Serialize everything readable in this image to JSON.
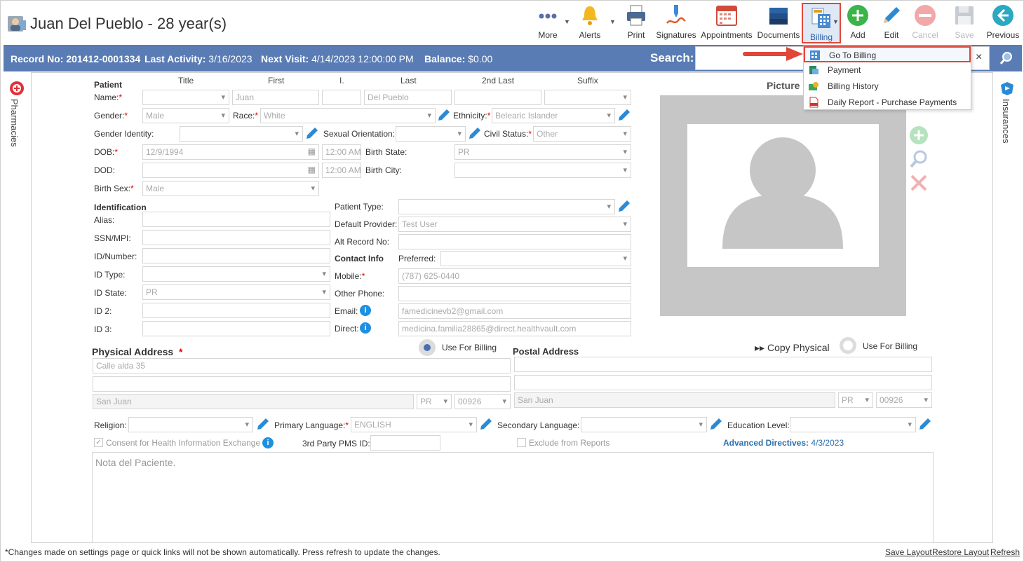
{
  "header": {
    "patient_title": "Juan Del Pueblo - 28 year(s)",
    "toolbar": {
      "more": "More",
      "alerts": "Alerts",
      "print": "Print",
      "signatures": "Signatures",
      "appointments": "Appointments",
      "documents": "Documents",
      "billing": "Billing",
      "add": "Add",
      "edit": "Edit",
      "cancel": "Cancel",
      "save": "Save",
      "previous": "Previous"
    }
  },
  "infobar": {
    "record_label": "Record No:",
    "record_value": "201412-0001334",
    "activity_label": "Last Activity:",
    "activity_value": "3/16/2023",
    "visit_label": "Next Visit:",
    "visit_value": "4/14/2023 12:00:00 PM",
    "balance_label": "Balance:",
    "balance_value": "$0.00",
    "search_label": "Search:",
    "search_clear": "×"
  },
  "billing_menu": {
    "items": [
      "Go To Billing",
      "Payment",
      "Billing History",
      "Daily Report - Purchase Payments"
    ]
  },
  "side": {
    "left": "Pharmacies",
    "right": "Insurances"
  },
  "patient": {
    "section": "Patient",
    "col_title": "Title",
    "col_first": "First",
    "col_i": "I.",
    "col_last": "Last",
    "col_2nd_last": "2nd Last",
    "col_suffix": "Suffix",
    "name_label": "Name:",
    "first": "Juan",
    "last": "Del Pueblo",
    "gender_label": "Gender:",
    "gender": "Male",
    "race_label": "Race:",
    "race": "White",
    "ethnicity_label": "Ethnicity:",
    "ethnicity": "Belearic Islander",
    "gender_identity_label": "Gender Identity:",
    "sexual_orientation_label": "Sexual Orientation:",
    "civil_status_label": "Civil Status:",
    "civil_status": "Other",
    "dob_label": "DOB:",
    "dob": "12/9/1994",
    "dob_time": "12:00 AM",
    "birth_state_label": "Birth State:",
    "birth_state": "PR",
    "dod_label": "DOD:",
    "dod_time": "12:00 AM",
    "birth_city_label": "Birth City:",
    "birth_sex_label": "Birth Sex:",
    "birth_sex": "Male",
    "picture_label": "Picture"
  },
  "identification": {
    "section": "Identification",
    "alias_label": "Alias:",
    "ssn_label": "SSN/MPI:",
    "idnum_label": "ID/Number:",
    "idtype_label": "ID Type:",
    "idstate_label": "ID State:",
    "idstate": "PR",
    "id2_label": "ID 2:",
    "id3_label": "ID 3:",
    "patient_type_label": "Patient Type:",
    "default_provider_label": "Default Provider:",
    "default_provider": "Test User",
    "alt_record_label": "Alt Record No:",
    "contact_section": "Contact Info",
    "preferred_label": "Preferred:",
    "mobile_label": "Mobile:",
    "mobile": "(787) 625-0440",
    "other_phone_label": "Other Phone:",
    "email_label": "Email:",
    "email": "famedicinevb2@gmail.com",
    "direct_label": "Direct:",
    "direct": "medicina.familia28865@direct.healthvault.com"
  },
  "address": {
    "physical_title": "Physical Address",
    "use_for_billing": "Use For Billing",
    "postal_title": "Postal Address",
    "copy_physical": "Copy Physical",
    "postal_use_for_billing": "Use For Billing",
    "line1": "Calle alda 35",
    "city": "San Juan",
    "state": "PR",
    "zip": "00926",
    "postal_city": "San Juan",
    "postal_state": "PR",
    "postal_zip": "00926"
  },
  "misc": {
    "religion_label": "Religion:",
    "primary_language_label": "Primary Language:",
    "primary_language": "ENGLISH",
    "secondary_language_label": "Secondary Language:",
    "education_label": "Education Level:",
    "consent_label": "Consent for Health Information Exchange",
    "third_party_label": "3rd Party PMS ID:",
    "exclude_label": "Exclude from Reports",
    "adv_directives_label": "Advanced Directives:",
    "adv_directives_date": "4/3/2023",
    "notes_placeholder": "Nota del Paciente."
  },
  "footer": {
    "note": "*Changes made on settings page or quick links will not be shown automatically. Press refresh to update the changes.",
    "save_layout": "Save Layout",
    "restore_layout": "Restore Layout",
    "refresh": "Refresh"
  },
  "colors": {
    "accent": "#5a7cb4",
    "highlight": "#e0463a",
    "link": "#2a6fb0"
  }
}
